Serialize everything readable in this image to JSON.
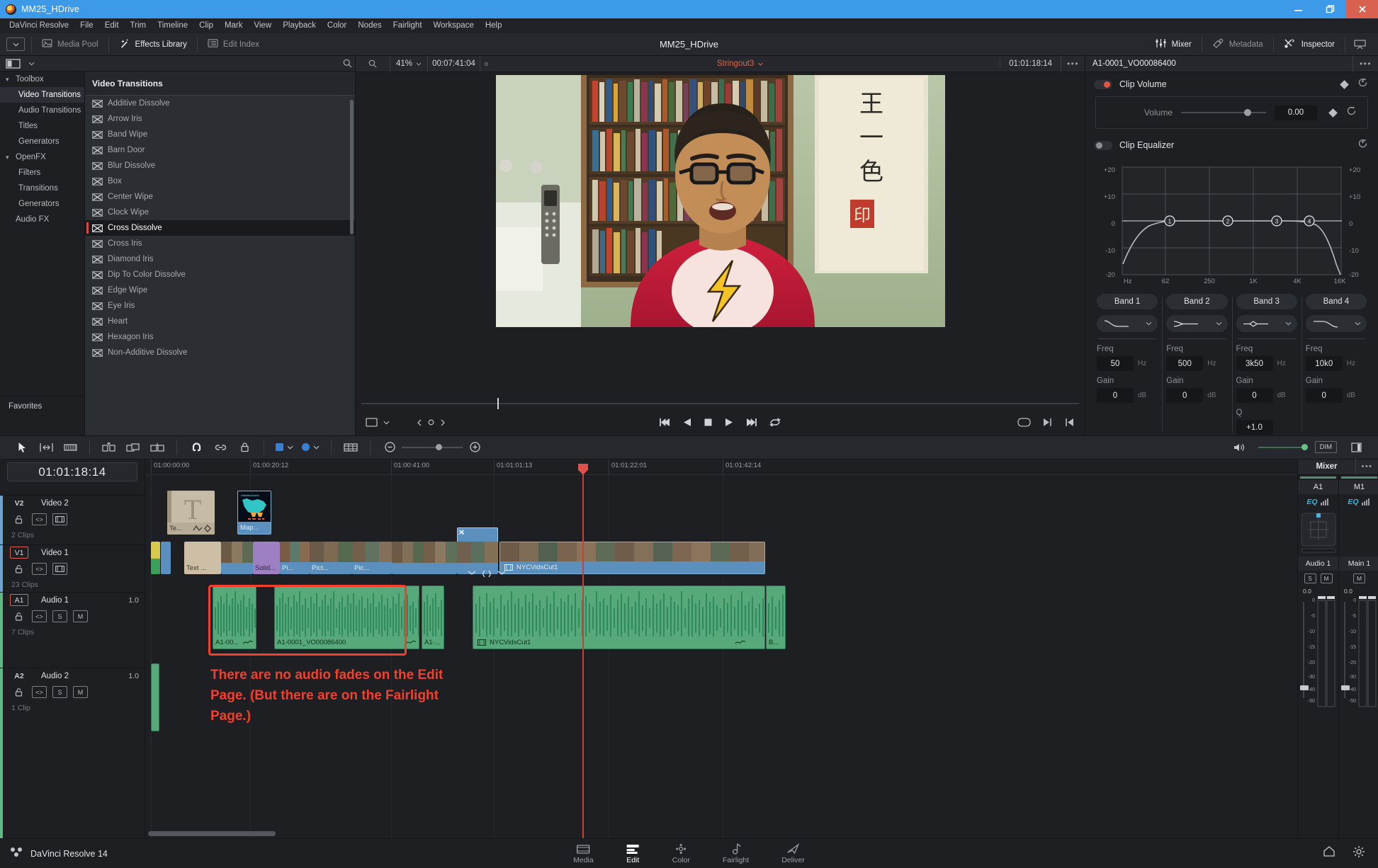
{
  "window": {
    "title": "MM25_HDrive",
    "app_icon": "resolve-logo-icon",
    "minimize": "minimize-icon",
    "maximize": "maximize-icon",
    "close": "close-icon"
  },
  "menubar": [
    "DaVinci Resolve",
    "File",
    "Edit",
    "Trim",
    "Timeline",
    "Clip",
    "Mark",
    "View",
    "Playback",
    "Color",
    "Nodes",
    "Fairlight",
    "Workspace",
    "Help"
  ],
  "toolbar": {
    "project_title": "MM25_HDrive",
    "left_buttons": [
      {
        "label": "Media Pool",
        "icon": "media-pool-icon",
        "active": false
      },
      {
        "label": "Effects Library",
        "icon": "effects-library-icon",
        "active": true
      },
      {
        "label": "Edit Index",
        "icon": "edit-index-icon",
        "active": false
      }
    ],
    "right_buttons": [
      {
        "label": "Mixer",
        "icon": "mixer-icon",
        "active": true
      },
      {
        "label": "Metadata",
        "icon": "metadata-icon",
        "active": false
      },
      {
        "label": "Inspector",
        "icon": "inspector-icon",
        "active": true
      }
    ]
  },
  "effects_library": {
    "tree": [
      {
        "label": "Toolbox",
        "level": 0,
        "expanded": true,
        "selected": false
      },
      {
        "label": "Video Transitions",
        "level": 1,
        "selected": true
      },
      {
        "label": "Audio Transitions",
        "level": 1,
        "selected": false
      },
      {
        "label": "Titles",
        "level": 1,
        "selected": false
      },
      {
        "label": "Generators",
        "level": 1,
        "selected": false
      },
      {
        "label": "OpenFX",
        "level": 0,
        "expanded": true,
        "selected": false
      },
      {
        "label": "Filters",
        "level": 1,
        "selected": false
      },
      {
        "label": "Transitions",
        "level": 1,
        "selected": false
      },
      {
        "label": "Generators",
        "level": 1,
        "selected": false
      },
      {
        "label": "Audio FX",
        "level": 1,
        "selected": false
      }
    ],
    "favorites_label": "Favorites",
    "list_title": "Video Transitions",
    "items": [
      {
        "label": "Additive Dissolve",
        "selected": false
      },
      {
        "label": "Arrow Iris",
        "selected": false
      },
      {
        "label": "Band Wipe",
        "selected": false
      },
      {
        "label": "Barn Door",
        "selected": false
      },
      {
        "label": "Blur Dissolve",
        "selected": false
      },
      {
        "label": "Box",
        "selected": false
      },
      {
        "label": "Center Wipe",
        "selected": false
      },
      {
        "label": "Clock Wipe",
        "selected": false
      },
      {
        "label": "Cross Dissolve",
        "selected": true
      },
      {
        "label": "Cross Iris",
        "selected": false
      },
      {
        "label": "Diamond Iris",
        "selected": false
      },
      {
        "label": "Dip To Color Dissolve",
        "selected": false
      },
      {
        "label": "Edge Wipe",
        "selected": false
      },
      {
        "label": "Eye Iris",
        "selected": false
      },
      {
        "label": "Heart",
        "selected": false
      },
      {
        "label": "Hexagon Iris",
        "selected": false
      },
      {
        "label": "Non-Additive Dissolve",
        "selected": false
      }
    ]
  },
  "viewer": {
    "zoom": "41%",
    "current_timecode": "00:07:41:04",
    "source_name": "Stringout3",
    "end_timecode": "01:01:18:14",
    "options_icon": "more-options-icon",
    "transport": [
      {
        "icon": "jump-to-start-icon"
      },
      {
        "icon": "play-reverse-icon"
      },
      {
        "icon": "stop-icon"
      },
      {
        "icon": "play-forward-icon"
      },
      {
        "icon": "jump-to-end-icon"
      },
      {
        "icon": "loop-icon"
      }
    ]
  },
  "inspector": {
    "clip_name": "A1-0001_VO00086400",
    "options_icon": "more-options-icon",
    "clip_volume": {
      "section_label": "Clip Volume",
      "enabled": true,
      "param_label": "Volume",
      "value": "0.00"
    },
    "clip_equalizer": {
      "section_label": "Clip Equalizer",
      "enabled": false,
      "graph": {
        "y_ticks": [
          "+20",
          "+10",
          "0",
          "-10",
          "-20"
        ],
        "x_ticks": [
          "Hz",
          "62",
          "250",
          "1K",
          "4K",
          "16K"
        ],
        "band_markers": [
          "1",
          "2",
          "3",
          "4"
        ]
      },
      "bands": [
        {
          "name": "Band 1",
          "shape": "low-shelf-icon",
          "freq_label": "Freq",
          "freq": "50",
          "freq_unit": "Hz",
          "gain_label": "Gain",
          "gain": "0",
          "gain_unit": "dB"
        },
        {
          "name": "Band 2",
          "shape": "low-mid-bell-icon",
          "freq_label": "Freq",
          "freq": "500",
          "freq_unit": "Hz",
          "gain_label": "Gain",
          "gain": "0",
          "gain_unit": "dB"
        },
        {
          "name": "Band 3",
          "shape": "bell-icon",
          "freq_label": "Freq",
          "freq": "3k50",
          "freq_unit": "Hz",
          "gain_label": "Gain",
          "gain": "0",
          "gain_unit": "dB",
          "q_label": "Q",
          "q": "+1.0"
        },
        {
          "name": "Band 4",
          "shape": "high-shelf-icon",
          "freq_label": "Freq",
          "freq": "10k0",
          "freq_unit": "Hz",
          "gain_label": "Gain",
          "gain": "0",
          "gain_unit": "dB"
        }
      ]
    }
  },
  "edit_toolbar": {
    "tools": [
      {
        "icon": "selection-arrow-icon",
        "active": true
      },
      {
        "icon": "trim-edit-icon",
        "active": false
      },
      {
        "icon": "dynamic-trim-icon",
        "active": false
      },
      {
        "icon": "razor-blade-icon",
        "active": false
      },
      {
        "icon": "insert-clip-icon",
        "active": false
      },
      {
        "icon": "overwrite-clip-icon",
        "active": false
      },
      {
        "icon": "replace-clip-icon",
        "active": false
      },
      {
        "icon": "snapping-magnet-icon",
        "active": true
      },
      {
        "icon": "linked-selection-icon",
        "active": false
      },
      {
        "icon": "lock-track-icon",
        "active": false
      },
      {
        "icon": "flag-icon",
        "color": "#3a7fd0"
      },
      {
        "icon": "marker-icon",
        "color": "#3a7fd0"
      },
      {
        "icon": "list-view-icon",
        "active": false
      }
    ],
    "zoom_out_icon": "zoom-out-icon",
    "zoom_in_icon": "zoom-in-icon",
    "speaker_icon": "speaker-icon",
    "dim_label": "DIM",
    "panel_icon": "panel-layout-icon"
  },
  "timeline": {
    "playhead_timecode": "01:01:18:14",
    "ruler_marks": [
      {
        "label": "01:00:00:00",
        "x": 8
      },
      {
        "label": "01:00:20:12",
        "x": 148
      },
      {
        "label": "01:00:41:00",
        "x": 347
      },
      {
        "label": "01:01:01:13",
        "x": 492
      },
      {
        "label": "01:01:22:01",
        "x": 654
      },
      {
        "label": "01:01:42:14",
        "x": 815
      }
    ],
    "tracks": [
      {
        "id": "V2",
        "name": "Video 2",
        "clips_label": "2 Clips",
        "armed": false,
        "type": "video",
        "color": "#6ba4cf"
      },
      {
        "id": "V1",
        "name": "Video 1",
        "clips_label": "23 Clips",
        "armed": true,
        "type": "video",
        "color": "#6ba4cf"
      },
      {
        "id": "A1",
        "name": "Audio 1",
        "clips_label": "7 Clips",
        "armed": true,
        "type": "audio",
        "color": "#5eb87f",
        "gain": "1.0"
      },
      {
        "id": "A2",
        "name": "Audio 2",
        "clips_label": "1 Clip",
        "armed": false,
        "type": "audio",
        "color": "#5eb87f",
        "gain": "1.0"
      }
    ],
    "track_buttons": {
      "lock": "lock-icon",
      "auto_select": "auto-select-icon",
      "video_toggle": "video-enable-icon",
      "solo": "S",
      "mute": "M"
    },
    "clip_labels": {
      "v2_text": "Te...",
      "v2_map": "Map...",
      "v1_text": "Text ...",
      "v1_solid": "Solid...",
      "v1_pi": "Pi...",
      "v1_pict": "Pict...",
      "v1_pic": "Pic...",
      "v1_nyc": "NYCVidsCut1",
      "a1_clip1": "A1-00...",
      "a1_clip2": "A1-0001_VO00086400",
      "a1_clip3": "A1-...",
      "a1_nyc": "NYCVidsCut1",
      "a1_b": "B..."
    }
  },
  "mixer": {
    "title": "Mixer",
    "options_icon": "more-options-icon",
    "strips": [
      {
        "id": "A1",
        "eq_label": "EQ",
        "name": "Audio 1",
        "buttons": [
          "S",
          "M"
        ],
        "fader_value": "0.0"
      },
      {
        "id": "M1",
        "eq_label": "EQ",
        "name": "Main 1",
        "buttons": [
          "M"
        ],
        "fader_value": "0.0"
      }
    ],
    "meter_ticks": [
      "0",
      "-5",
      "-10",
      "-15",
      "-20",
      "-30",
      "-40",
      "-50"
    ]
  },
  "annotation": {
    "text_lines": [
      "There are no audio fades on the Edit",
      "Page. (But there are on the Fairlight",
      "Page.)"
    ],
    "color": "#f2402f"
  },
  "statusbar": {
    "brand": "DaVinci Resolve 14",
    "brand_icon": "resolve-dots-icon",
    "pages": [
      {
        "label": "Media",
        "icon": "media-page-icon",
        "active": false
      },
      {
        "label": "Edit",
        "icon": "edit-page-icon",
        "active": true
      },
      {
        "label": "Color",
        "icon": "color-page-icon",
        "active": false
      },
      {
        "label": "Fairlight",
        "icon": "fairlight-page-icon",
        "active": false
      },
      {
        "label": "Deliver",
        "icon": "deliver-page-icon",
        "active": false
      }
    ],
    "right_icons": [
      {
        "icon": "home-icon"
      },
      {
        "icon": "settings-gear-icon"
      }
    ]
  }
}
